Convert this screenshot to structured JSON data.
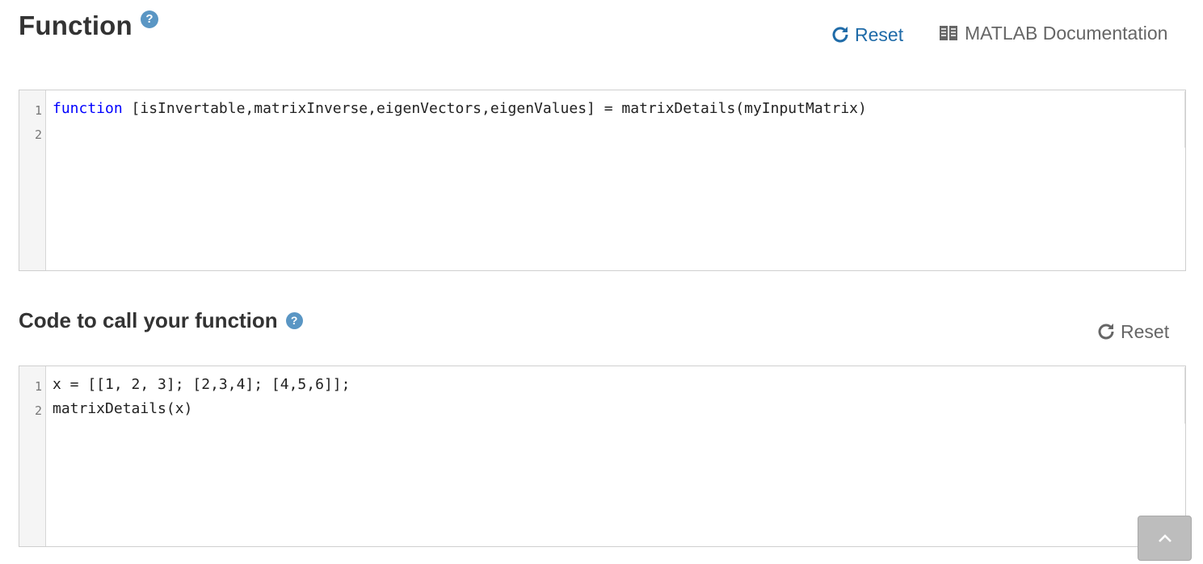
{
  "function_section": {
    "title": "Function",
    "help_icon": "question-circle-icon",
    "reset_label": "Reset",
    "reset_icon": "refresh-icon",
    "docs_label": "MATLAB Documentation",
    "docs_icon": "book-icon",
    "editor": {
      "line_numbers": [
        "1",
        "2"
      ],
      "line1_keyword": "function",
      "line1_rest": " [isInvertable,matrixInverse,eigenVectors,eigenValues] = matrixDetails(myInputMatrix)",
      "line2": ""
    }
  },
  "call_section": {
    "title": "Code to call your function",
    "help_icon": "question-circle-icon",
    "reset_label": "Reset",
    "reset_icon": "refresh-icon",
    "editor": {
      "line_numbers": [
        "1",
        "2"
      ],
      "lines": [
        "x = [[1, 2, 3]; [2,3,4]; [4,5,6]];",
        "matrixDetails(x)"
      ]
    }
  },
  "back_to_top": {
    "icon": "chevron-up-icon"
  },
  "colors": {
    "link_blue": "#1f6ba8",
    "help_blue": "#5a96c4",
    "keyword_blue": "#0000ff",
    "muted_grey": "#666666"
  }
}
